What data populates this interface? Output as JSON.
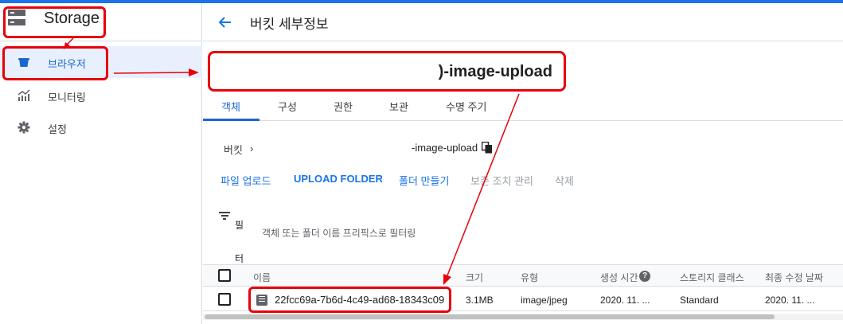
{
  "sidebar": {
    "title": "Storage",
    "items": [
      {
        "label": "브라우저",
        "icon": "bucket-icon",
        "active": true
      },
      {
        "label": "모니터링",
        "icon": "monitoring-chart-icon",
        "active": false
      },
      {
        "label": "설정",
        "icon": "gear-icon",
        "active": false
      }
    ]
  },
  "header": {
    "back_icon": "arrow-left-icon",
    "title": "버킷 세부정보"
  },
  "bucket": {
    "name": ")-image-upload"
  },
  "tabs": [
    "객체",
    "구성",
    "권한",
    "보관",
    "수명 주기"
  ],
  "breadcrumb": {
    "root": "버킷",
    "bucket": "-image-upload",
    "copy_icon": "copy-icon"
  },
  "actions": {
    "upload_files": "파일 업로드",
    "upload_folder": "UPLOAD FOLDER",
    "create_folder": "폴더 만들기",
    "manage_holds": "보존 조치 관리",
    "delete": "삭제"
  },
  "filter": {
    "label": "필터",
    "placeholder": "객체 또는 폴더 이름 프리픽스로 필터링"
  },
  "table": {
    "columns": [
      "이름",
      "크기",
      "유형",
      "생성 시간",
      "스토리지 클래스",
      "최종 수정 날짜"
    ],
    "rows": [
      {
        "name": "22fcc69a-7b6d-4c49-ad68-18343c09",
        "size": "3.1MB",
        "type": "image/jpeg",
        "created": "2020. 11. ...",
        "storage_class": "Standard",
        "modified": "2020. 11. ..."
      }
    ]
  },
  "colors": {
    "accent": "#1a73e8",
    "highlight": "#e8000b",
    "active_bg": "#e8f0fe"
  }
}
